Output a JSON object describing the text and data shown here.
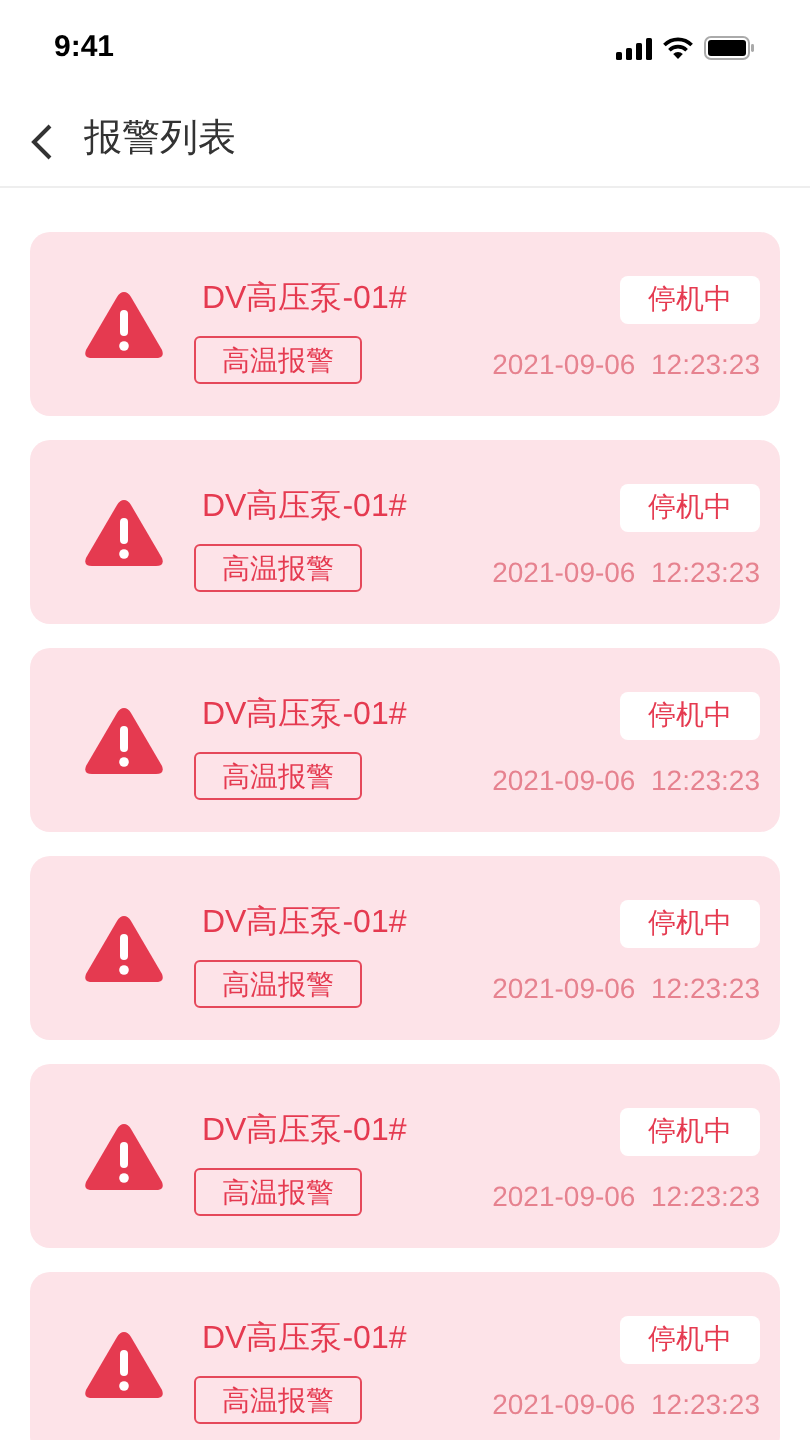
{
  "status_bar": {
    "time": "9:41"
  },
  "nav": {
    "title": "报警列表"
  },
  "alarms": [
    {
      "device": "DV高压泵-01#",
      "tag": "高温报警",
      "status": "停机中",
      "time": "2021-09-06  12:23:23"
    },
    {
      "device": "DV高压泵-01#",
      "tag": "高温报警",
      "status": "停机中",
      "time": "2021-09-06  12:23:23"
    },
    {
      "device": "DV高压泵-01#",
      "tag": "高温报警",
      "status": "停机中",
      "time": "2021-09-06  12:23:23"
    },
    {
      "device": "DV高压泵-01#",
      "tag": "高温报警",
      "status": "停机中",
      "time": "2021-09-06  12:23:23"
    },
    {
      "device": "DV高压泵-01#",
      "tag": "高温报警",
      "status": "停机中",
      "time": "2021-09-06  12:23:23"
    },
    {
      "device": "DV高压泵-01#",
      "tag": "高温报警",
      "status": "停机中",
      "time": "2021-09-06  12:23:23"
    }
  ]
}
